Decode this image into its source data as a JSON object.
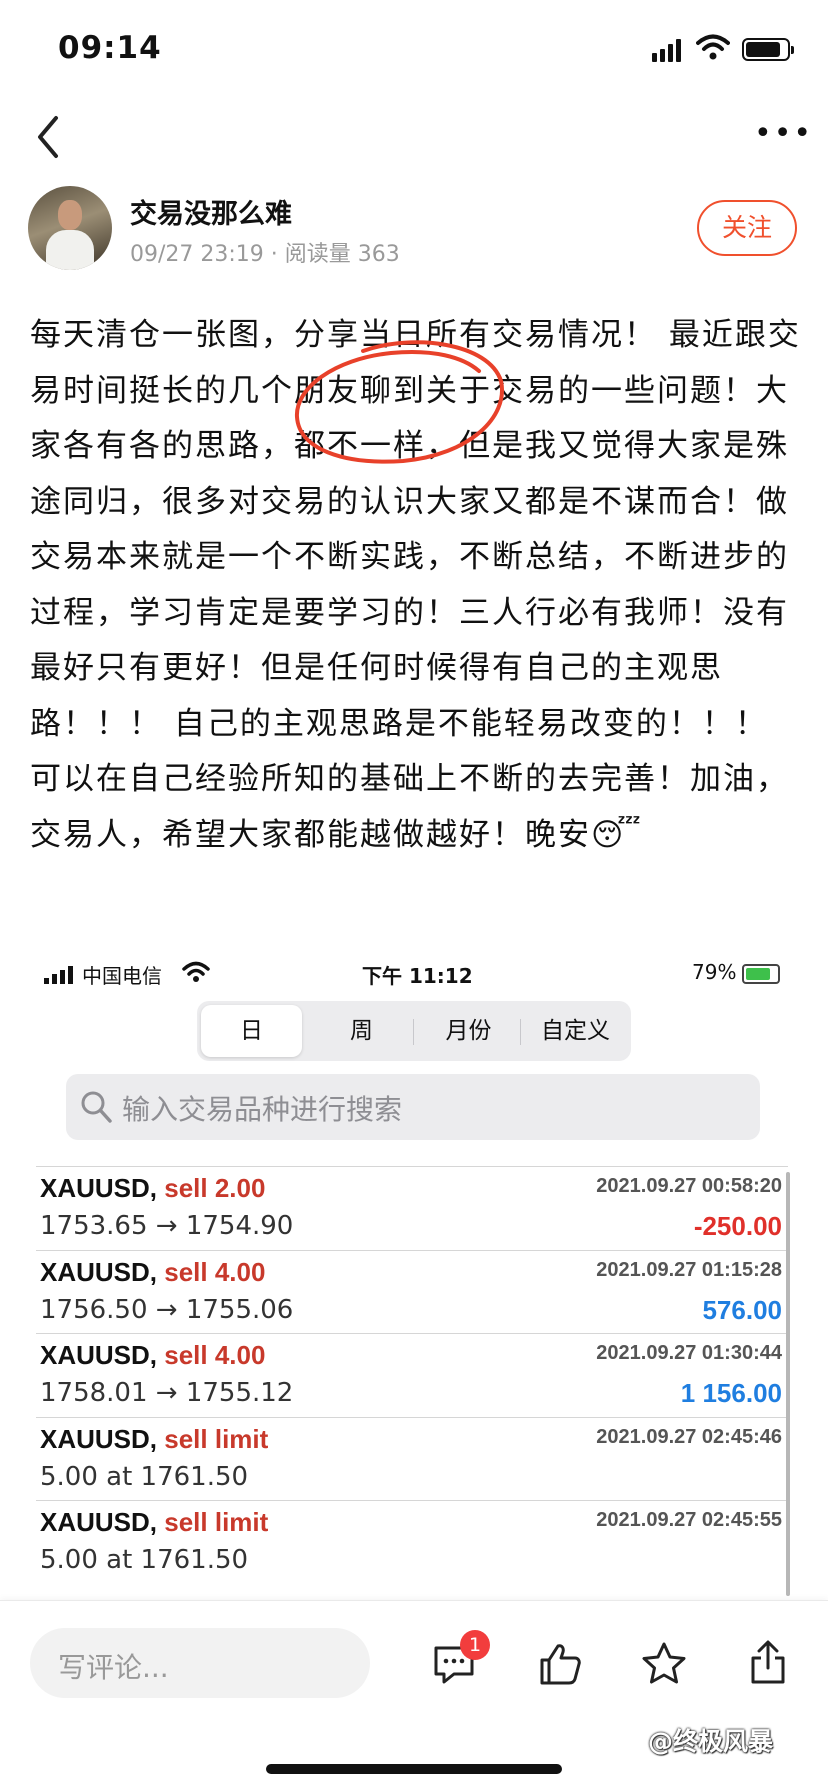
{
  "status_bar": {
    "time": "09:14"
  },
  "nav": {
    "back": "back",
    "more": "•••"
  },
  "author": {
    "name": "交易没那么难",
    "meta": "09/27 23:19 · 阅读量 363",
    "follow_label": "关注"
  },
  "article": {
    "text": "每天清仓一张图，分享当日所有交易情况！ 最近跟交易时间挺长的几个朋友聊到关于交易的一些问题！大家各有各的思路，都不一样，但是我又觉得大家是殊途同归，很多对交易的认识大家又都是不谋而合！做交易本来就是一个不断实践，不断总结，不断进步的过程，学习肯定是要学习的！三人行必有我师！没有最好只有更好！但是任何时候得有自己的主观思路！！！ 自己的主观思路是不能轻易改变的！！！ 可以在自己经验所知的基础上不断的去完善！加油，交易人，希望大家都能越做越好！晚安😴"
  },
  "embedded": {
    "status_bar": {
      "carrier": "中国电信",
      "time": "下午 11:12",
      "battery": "79%",
      "battery_level": 0.79
    },
    "tabs": [
      "日",
      "周",
      "月份",
      "自定义"
    ],
    "active_tab": 0,
    "search_placeholder": "输入交易品种进行搜索",
    "trades": [
      {
        "symbol": "XAUUSD,",
        "side": "sell 2.00",
        "time": "2021.09.27 00:58:20",
        "price": "1753.65 → 1754.90",
        "profit": "-250.00",
        "profit_color": "#e0302a"
      },
      {
        "symbol": "XAUUSD,",
        "side": "sell 4.00",
        "time": "2021.09.27 01:15:28",
        "price": "1756.50 → 1755.06",
        "profit": "576.00",
        "profit_color": "#1f7ee0"
      },
      {
        "symbol": "XAUUSD,",
        "side": "sell 4.00",
        "time": "2021.09.27 01:30:44",
        "price": "1758.01 → 1755.12",
        "profit": "1 156.00",
        "profit_color": "#1f7ee0"
      },
      {
        "symbol": "XAUUSD,",
        "side": "sell limit",
        "time": "2021.09.27 02:45:46",
        "price": "5.00 at 1761.50",
        "profit": "",
        "profit_color": "#111111"
      },
      {
        "symbol": "XAUUSD,",
        "side": "sell limit",
        "time": "2021.09.27 02:45:55",
        "price": "5.00 at 1761.50",
        "profit": "",
        "profit_color": "#111111"
      }
    ]
  },
  "bottom_bar": {
    "comment_placeholder": "写评论...",
    "comment_count_badge": "1",
    "icons": [
      "comment-icon",
      "like-icon",
      "star-icon",
      "share-icon"
    ],
    "watermark": "@终极风暴"
  },
  "colors": {
    "accent": "#f0502d",
    "loss": "#e0302a",
    "profit": "#1f7ee0",
    "sell": "#c8392b"
  }
}
